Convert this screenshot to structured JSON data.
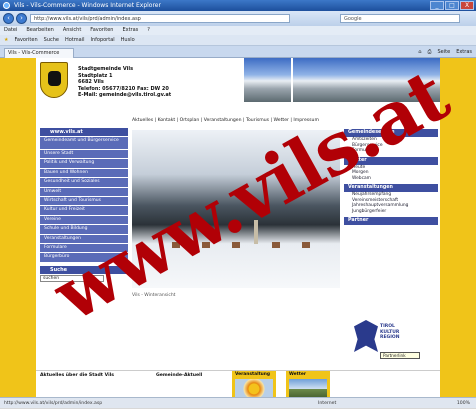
{
  "window": {
    "title": "Vils - Vils-Commerce - Windows Internet Explorer",
    "buttons": [
      "_",
      "□",
      "X"
    ]
  },
  "address_bar": {
    "url": "http://www.vils.at/vils/prd/admin/index.asp",
    "search_placeholder": "Google"
  },
  "menu": [
    "Datei",
    "Bearbeiten",
    "Ansicht",
    "Favoriten",
    "Extras",
    "?"
  ],
  "favorites_bar": [
    "Favoriten",
    "Suche",
    "Hotmail",
    "Infoportal",
    "Huslo"
  ],
  "tab": {
    "label": "Vils - Vils-Commerce"
  },
  "command_bar": [
    "Seite",
    "Extras"
  ],
  "header": {
    "address_lines": [
      "Stadtgemeinde Vils",
      "Stadtplatz 1",
      "6682 Vils",
      "Telefon: 05677/8210 Fax: DW 20",
      "E-Mail: gemeinde@vils.tirol.gv.at"
    ]
  },
  "topnav": "Aktuelles | Kontakt | Ortsplan | Veranstaltungen | Tourismus | Wetter | Impressum",
  "sidebar": {
    "head": "www.vils.at",
    "items": [
      "Gemeindeamt und Bürgerservice",
      "Unsere Stadt",
      "Politik und Verwaltung",
      "Bauen und Wohnen",
      "Gesundheit und Soziales",
      "Umwelt",
      "Wirtschaft und Tourismus",
      "Kultur und Freizeit",
      "Vereine",
      "Schule und Bildung",
      "Veranstaltungen",
      "Formulare",
      "Bürgerbüro"
    ],
    "search_head": "Suche",
    "search_value": "suchen"
  },
  "caption": "Vils - Winteransicht",
  "right_col": [
    {
      "head": "Gemeindeservice",
      "links": [
        "Amtszeiten",
        "Bürgerservice",
        "Formulare"
      ]
    },
    {
      "head": "Wetter",
      "links": [
        "Heute",
        "Morgen",
        "Webcam"
      ]
    },
    {
      "head": "Veranstaltungen",
      "links": [
        "Neujahrsempfang",
        "Vereinsmeisterschaft",
        "Jahreshauptversammlung",
        "Jungbürgerfeier"
      ]
    },
    {
      "head": "Partner",
      "links": []
    }
  ],
  "partner_logo_text": [
    "TIROL",
    "KULTUR",
    "REGION"
  ],
  "tooltip": "Partnerlink",
  "bottom": {
    "left_label": "Aktuelles über die Stadt Vils",
    "mid_label": "Gemeinde-Aktuell",
    "thumb1": "Veranstaltung",
    "thumb2": "Wetter"
  },
  "watermark": "www.vils.at",
  "status": {
    "text": "http://www.vils.at/vils/prd/admin/index.asp",
    "zone": "Internet",
    "zoom": "100%"
  }
}
